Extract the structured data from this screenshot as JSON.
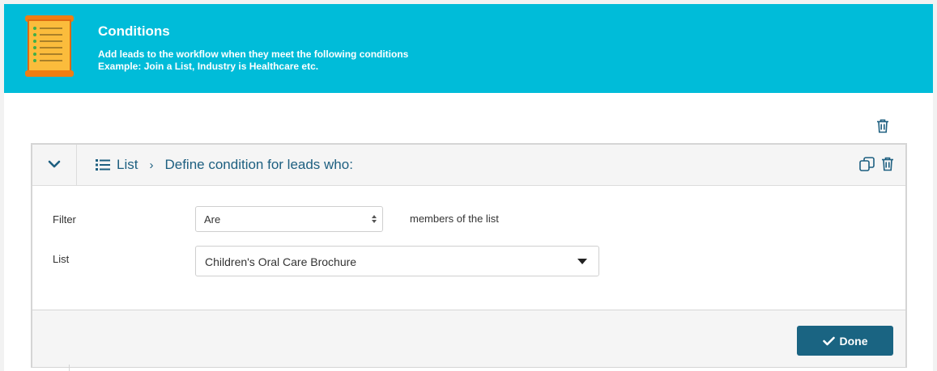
{
  "header": {
    "title": "Conditions",
    "description": "Add leads to the workflow when they meet the following conditions",
    "example_label": "Example:",
    "example_text": "Join a List, Industry is Healthcare etc.",
    "background_color": "#00bcd9",
    "icon": "scroll-checklist-icon"
  },
  "panel": {
    "breadcrumb_type": "List",
    "breadcrumb_title": "Define condition for leads who:",
    "collapse_icon": "chevron-down-icon",
    "actions": [
      "copy-icon",
      "trash-icon"
    ],
    "fields": {
      "filter_label": "Filter",
      "filter_value": "Are",
      "filter_suffix": "members of the list",
      "list_label": "List",
      "list_value": "Children's Oral Care Brochure"
    },
    "done_label": "Done",
    "accent_color": "#1a6482"
  }
}
